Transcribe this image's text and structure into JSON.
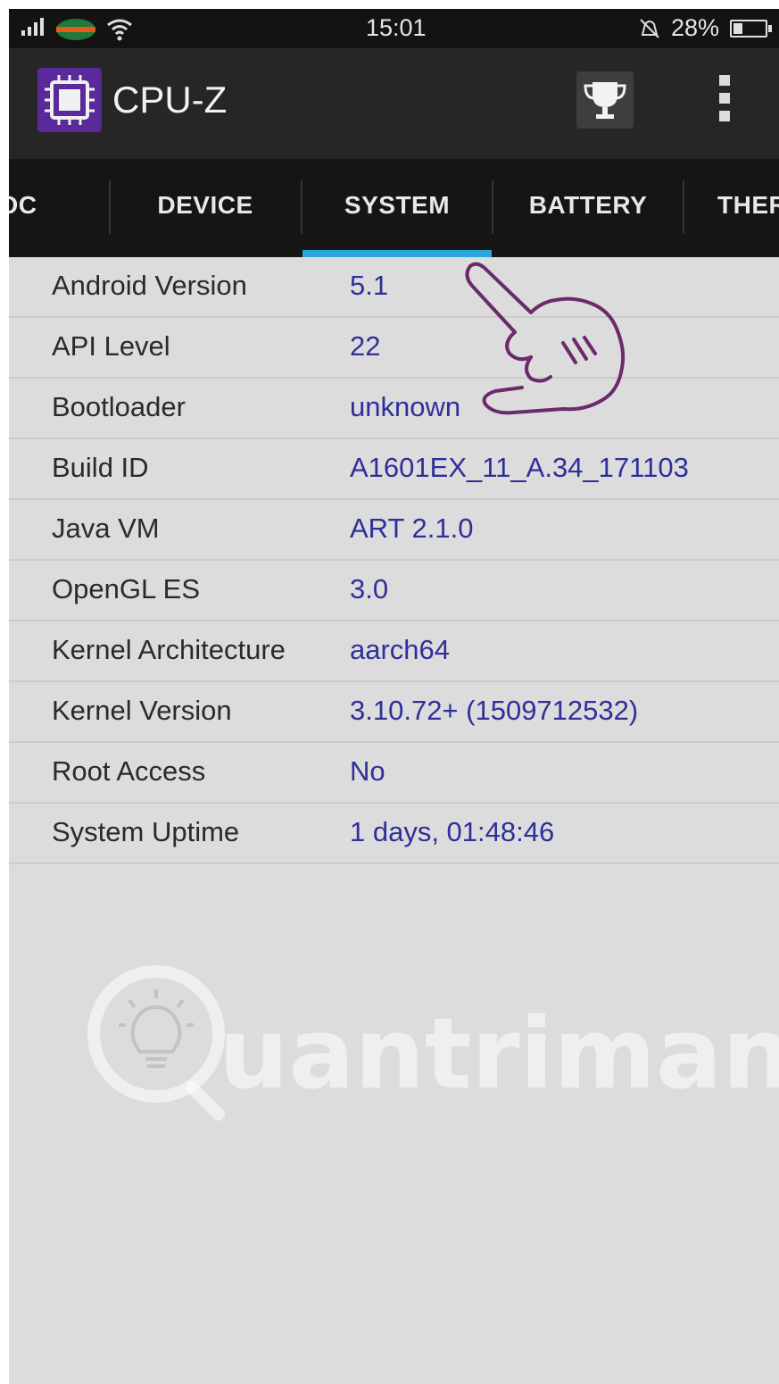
{
  "status_bar": {
    "time": "15:01",
    "battery_percent": "28%",
    "icons": [
      "signal-icon",
      "carrier-icon",
      "wifi-icon",
      "alarm-off-icon",
      "battery-icon"
    ]
  },
  "app_bar": {
    "title": "CPU-Z",
    "app_icon": "cpu-chip-icon",
    "actions": [
      "trophy-icon",
      "overflow-menu-icon"
    ]
  },
  "tabs": [
    {
      "label": "OC"
    },
    {
      "label": "DEVICE"
    },
    {
      "label": "SYSTEM",
      "selected": true
    },
    {
      "label": "BATTERY"
    },
    {
      "label": "THER"
    }
  ],
  "system_info": [
    {
      "label": "Android Version",
      "value": "5.1"
    },
    {
      "label": "API Level",
      "value": "22"
    },
    {
      "label": "Bootloader",
      "value": "unknown"
    },
    {
      "label": "Build ID",
      "value": "A1601EX_11_A.34_171103"
    },
    {
      "label": "Java VM",
      "value": "ART 2.1.0"
    },
    {
      "label": "OpenGL ES",
      "value": "3.0"
    },
    {
      "label": "Kernel Architecture",
      "value": "aarch64"
    },
    {
      "label": "Kernel Version",
      "value": "3.10.72+ (1509712532)"
    },
    {
      "label": "Root Access",
      "value": "No"
    },
    {
      "label": "System Uptime",
      "value": "1 days, 01:48:46"
    }
  ],
  "watermark": {
    "text": "uantrimang"
  },
  "colors": {
    "tab_indicator": "#2aa6dc",
    "value_text": "#2e2f9a",
    "app_icon_bg": "#5a2a9a",
    "annotation": "#6b2a6b"
  }
}
